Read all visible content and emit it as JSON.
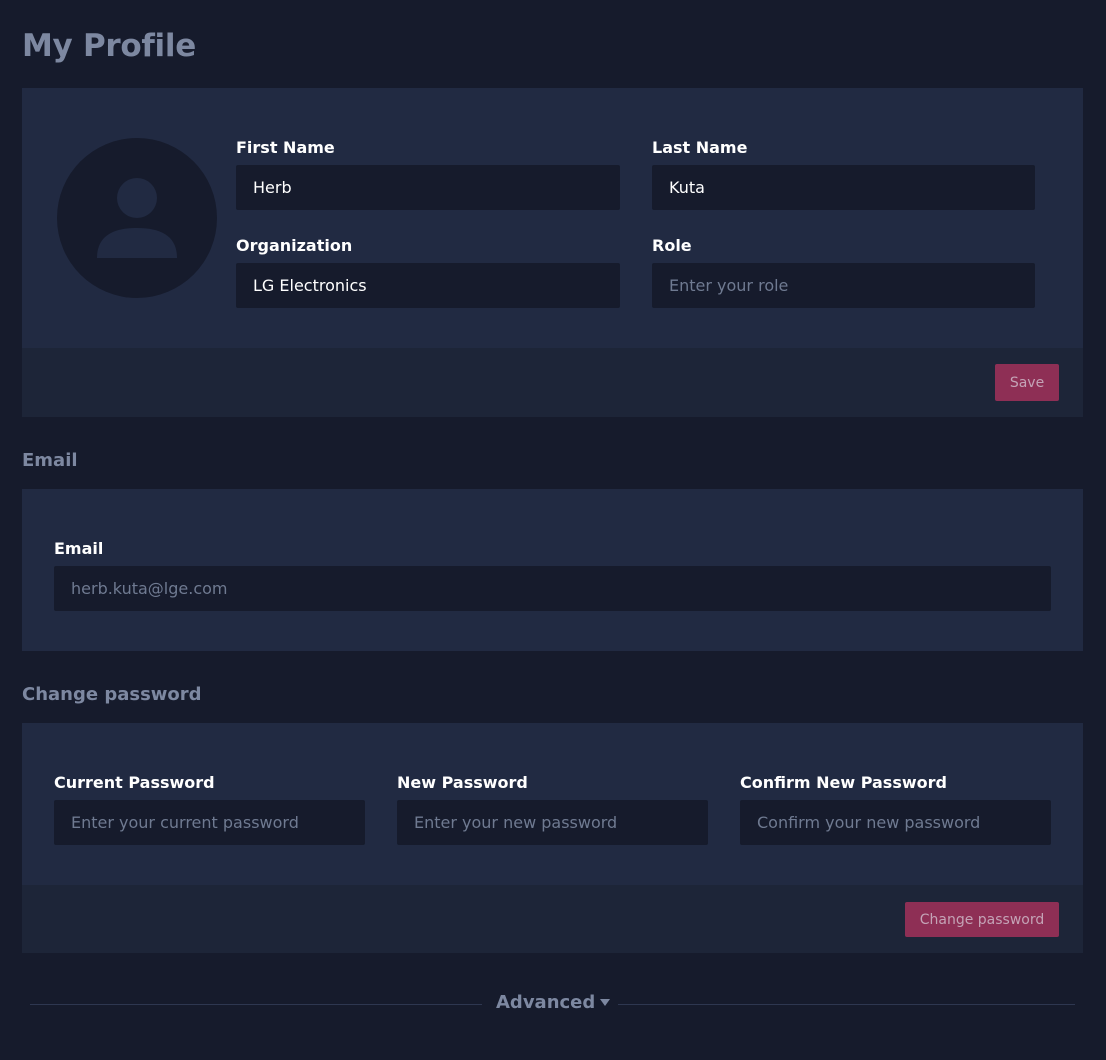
{
  "page": {
    "title": "My Profile"
  },
  "profile": {
    "first_name": {
      "label": "First Name",
      "value": "Herb",
      "placeholder": ""
    },
    "last_name": {
      "label": "Last Name",
      "value": "Kuta",
      "placeholder": ""
    },
    "organization": {
      "label": "Organization",
      "value": "LG Electronics",
      "placeholder": ""
    },
    "role": {
      "label": "Role",
      "value": "",
      "placeholder": "Enter your role"
    },
    "save_label": "Save",
    "avatar_icon": "user-silhouette-icon"
  },
  "email_section": {
    "title": "Email",
    "email": {
      "label": "Email",
      "value": "",
      "placeholder": "herb.kuta@lge.com"
    }
  },
  "password_section": {
    "title": "Change password",
    "current": {
      "label": "Current Password",
      "value": "",
      "placeholder": "Enter your current password"
    },
    "new": {
      "label": "New Password",
      "value": "",
      "placeholder": "Enter your new password"
    },
    "confirm": {
      "label": "Confirm New Password",
      "value": "",
      "placeholder": "Confirm your new password"
    },
    "submit_label": "Change password"
  },
  "advanced": {
    "label": "Advanced",
    "icon": "chevron-down-icon"
  },
  "colors": {
    "background": "#161b2c",
    "panel": "#212a42",
    "panel_footer": "#1d2538",
    "accent": "#8e2f55",
    "muted_text": "#7d88a1"
  }
}
